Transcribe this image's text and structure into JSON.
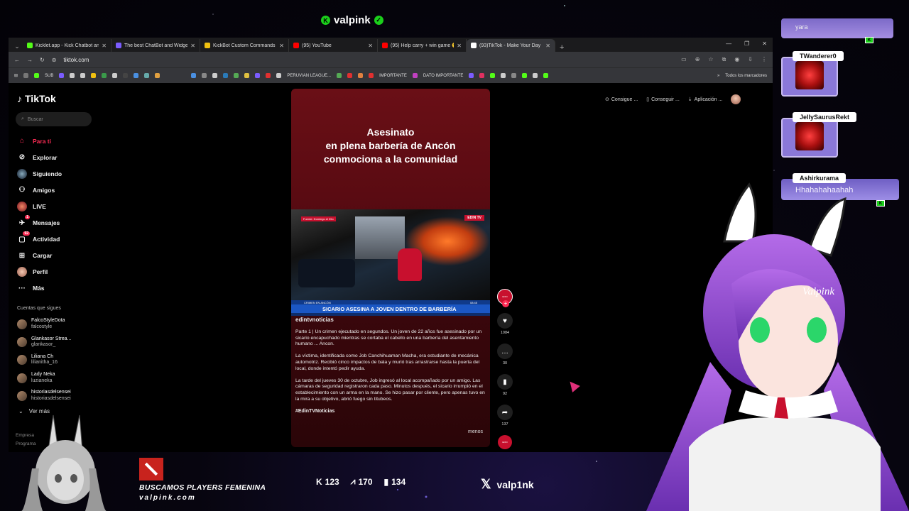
{
  "stream": {
    "channel_title": "valpink",
    "stats": {
      "followers": "123",
      "likes": "170",
      "viewers": "134"
    },
    "x_handle": "valp1nk",
    "promo_line1": "BUSCAMOS PLAYERS FEMENINA",
    "promo_line2": "valpink.com",
    "avatar_logo": "Valpink"
  },
  "browser": {
    "tabs": [
      {
        "label": "Kicklet.app - Kick Chatbot and",
        "color": "#53fc18"
      },
      {
        "label": "The best ChatBot and Widgets",
        "color": "#7b5cff"
      },
      {
        "label": "KickBot Custom Commands",
        "color": "#f0c010"
      },
      {
        "label": "(95) YouTube",
        "color": "#ff0000"
      },
      {
        "label": "(95) Help carry + win game 😮",
        "color": "#ff0000"
      },
      {
        "label": "(93)TikTok - Make Your Day",
        "color": "#ffffff"
      }
    ],
    "address": "tiktok.com",
    "bookmarks": {
      "sub_label": "SUB",
      "peruvian": "PERUVIAN LEAGUE...",
      "importante": "IMPORTANTE",
      "dato": "DATO IMPORTANTE",
      "todos": "Todos los marcadores"
    }
  },
  "tiktok": {
    "logo": "TikTok",
    "search_placeholder": "Buscar",
    "nav": [
      {
        "label": "Para ti",
        "icon": "home-icon"
      },
      {
        "label": "Explorar",
        "icon": "compass-icon"
      },
      {
        "label": "Siguiendo",
        "icon": "following-icon"
      },
      {
        "label": "Amigos",
        "icon": "friends-icon"
      },
      {
        "label": "LIVE",
        "icon": "live-icon"
      },
      {
        "label": "Mensajes",
        "icon": "messages-icon",
        "badge": "1"
      },
      {
        "label": "Actividad",
        "icon": "activity-icon",
        "badge": "92"
      },
      {
        "label": "Cargar",
        "icon": "upload-icon"
      },
      {
        "label": "Perfil",
        "icon": "profile-icon"
      },
      {
        "label": "Más",
        "icon": "more-icon"
      }
    ],
    "following_title": "Cuentas que sigues",
    "following": [
      {
        "name": "FalcoStyleDota",
        "handle": "falcostyle"
      },
      {
        "name": "Glankasor Strea...",
        "handle": "glankasor_"
      },
      {
        "name": "Liliana Ch",
        "handle": "lilianitha_16"
      },
      {
        "name": "Lady Neka",
        "handle": "luzianeka"
      },
      {
        "name": "historiasdelsensei",
        "handle": "historiasdelsensei"
      }
    ],
    "see_more": "Ver más",
    "footer": [
      "Empresa",
      "Programa"
    ],
    "top_actions": [
      "Consigue ...",
      "Conseguir ...",
      "Aplicación ..."
    ],
    "video": {
      "headline": [
        "Asesinato",
        "en plena barbería de Ancón",
        "conmociona a la comunidad"
      ],
      "fuente": "Fuente: Domingo el 35o",
      "channel_badge": "EDIN TV",
      "ticker_left": "CRIMEN EN ANCÓN",
      "time": "08:45",
      "ticker_main": "SICARIO ASESINA A JOVEN DENTRO DE BARBERÍA",
      "username": "edintvnoticias",
      "p1": "Parte 1 | Un crimen ejecutado en segundos. Un joven de 22 años fue asesinado por un sicario encapuchado mientras se cortaba el cabello en una barbería del asentamiento humano ... Ancon.",
      "p2": "La víctima, identificada como Job Canchihuaman Macha, era estudiante de mecánica automotriz. Recibió cinco impactos de bala y murió tras arrastrarse hasta la puerta del local, donde intentó pedir ayuda.",
      "p3": "La tarde del jueves 30 de octubre, Job ingresó al local acompañado por un amigo. Las cámaras de seguridad registraron cada paso. Minutos después, el sicario irrumpió en el establecimiento con un arma en la mano. Se hizo pasar por cliente, pero apenas tuvo en la mira a su objetivo, abrió fuego sin titubeos.",
      "hashtag": "#EdinTVNoticias",
      "less": "menos",
      "likes": "1084",
      "comments": "30",
      "saves": "92",
      "shares": "137"
    }
  },
  "chat": {
    "top_msg": "yara",
    "messages": [
      {
        "user": "TWanderer0"
      },
      {
        "user": "JellySaurusRekt"
      },
      {
        "user": "Ashirkurama",
        "text": "Hhahahahaahah"
      }
    ]
  },
  "colors": {
    "tiktok_accent": "#fe2c55",
    "kick_green": "#53fc18",
    "chat_purple": "#8a78d8"
  }
}
